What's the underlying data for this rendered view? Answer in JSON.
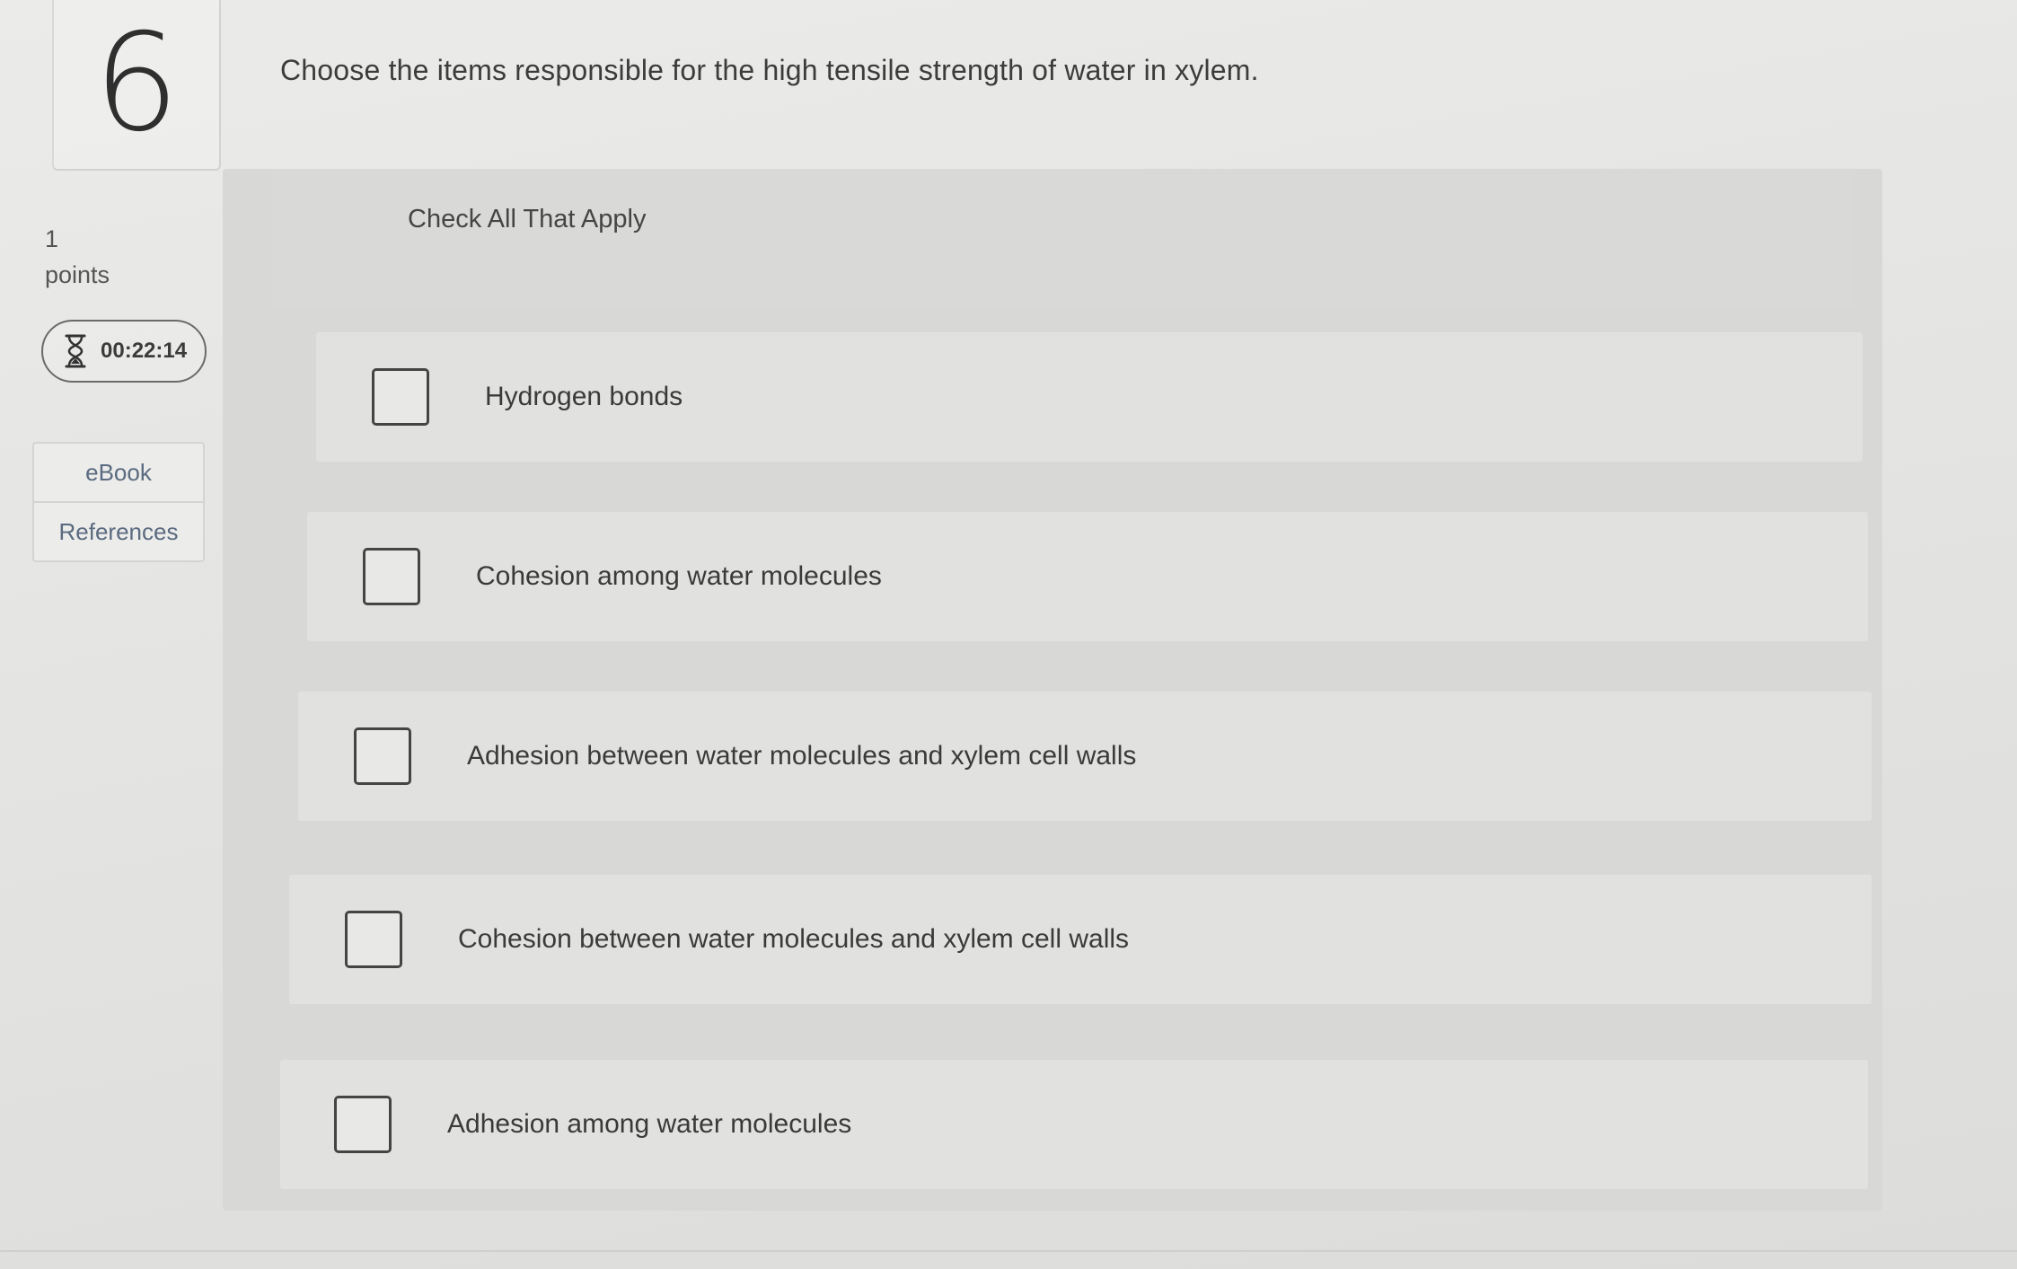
{
  "question": {
    "number": "6",
    "prompt": "Choose the items responsible for the high tensile strength of water in xylem."
  },
  "sidebar": {
    "points_value": "1",
    "points_label": "points",
    "timer": "00:22:14",
    "resources": [
      {
        "label": "eBook"
      },
      {
        "label": "References"
      }
    ]
  },
  "answer_panel": {
    "title": "Check All That Apply",
    "options": [
      {
        "label": "Hydrogen bonds",
        "checked": false
      },
      {
        "label": "Cohesion among water molecules",
        "checked": false
      },
      {
        "label": "Adhesion between water molecules and xylem cell walls",
        "checked": false
      },
      {
        "label": "Cohesion between water molecules and xylem cell walls",
        "checked": false
      },
      {
        "label": "Adhesion among water molecules",
        "checked": false
      }
    ]
  },
  "icons": {
    "timer": "hourglass-icon"
  }
}
